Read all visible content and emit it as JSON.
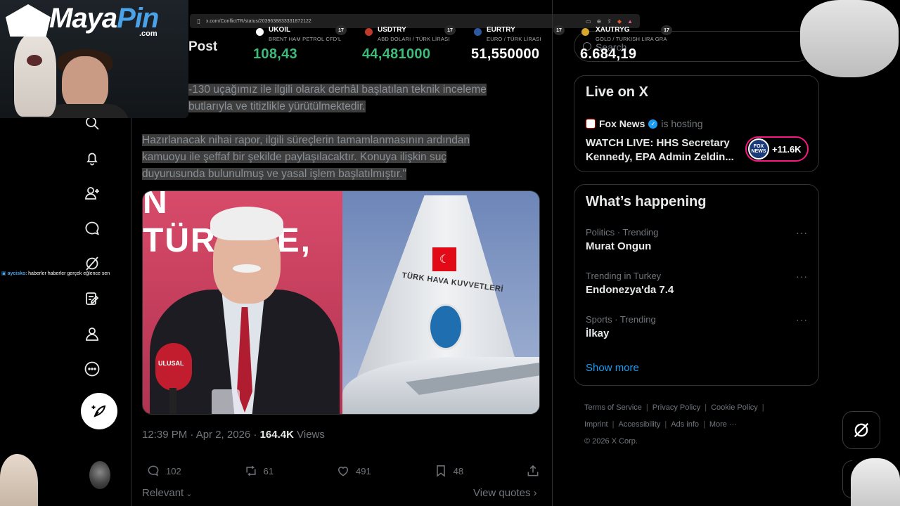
{
  "browser": {
    "url": "x.com/ConflictTR/status/2039638833331872122"
  },
  "ticker": [
    {
      "symbol": "UKOIL",
      "desc": "BRENT HAM PETROL CFD'L",
      "value": "108,43",
      "value_color": "#3dbb7a",
      "dot_color": "#ffffff",
      "tv": "17"
    },
    {
      "symbol": "USDTRY",
      "desc": "ABD DOLARI / TÜRK LİRASI",
      "value": "44,481000",
      "value_color": "#3dbb7a",
      "dot_color": "#c0392b",
      "tv": "17"
    },
    {
      "symbol": "EURTRY",
      "desc": "EURO / TÜRK LİRASI",
      "value": "51,550000",
      "value_color": "#ffffff",
      "dot_color": "#2c5aa0",
      "tv": "17"
    },
    {
      "symbol": "XAUTRYG",
      "desc": "GOLD / TURKISH LIRA GRA",
      "value": "6.684,19",
      "value_color": "#ffffff",
      "dot_color": "#d4a82b",
      "tv": "17"
    }
  ],
  "search": {
    "placeholder": "Search"
  },
  "post": {
    "header": "Post",
    "paragraph1_line1": "-130 uçağımız ile ilgili olarak derhâl başlatılan teknik inceleme",
    "paragraph1_line2": "butlarıyla ve titizlikle yürütülmektedir.",
    "paragraph2_line1": "Hazırlanacak nihai rapor, ilgili süreçlerin tamamlanmasının ardından",
    "paragraph2_line2": "kamuoyu ile şeffaf bir şekilde paylaşılacaktır. Konuya ilişkin suç",
    "paragraph2_line3": "duyurusunda bulunulmuş ve yasal işlem başlatılmıştır.\"",
    "image_banner_text": "N TÜRKİYE,",
    "mic_label": "ULUSAL",
    "plane_text": "TÜRK HAVA KUVVETLERİ",
    "time": "12:39 PM · Apr 2, 2026 · ",
    "views_count": "164.4K",
    "views_label": "Views",
    "replies": "102",
    "reposts": "61",
    "likes": "491",
    "bookmarks": "48",
    "relevant": "Relevant",
    "view_quotes": "View quotes"
  },
  "live": {
    "title": "Live on X",
    "host_name": "Fox News",
    "host_suffix": "is hosting",
    "stream_title": "WATCH LIVE: HHS Secretary Kennedy, EPA Admin Zeldin...",
    "listener_count": "+11.6K",
    "badge_text": "FOX NEWS"
  },
  "happening": {
    "title": "What’s happening",
    "trends": [
      {
        "meta": "Politics · Trending",
        "topic": "Murat Ongun"
      },
      {
        "meta": "Trending in Turkey",
        "topic": "Endonezya'da 7.4"
      },
      {
        "meta": "Sports · Trending",
        "topic": "İlkay"
      }
    ],
    "show_more": "Show more",
    "more_glyph": "···"
  },
  "footer": {
    "links": [
      "Terms of Service",
      "Privacy Policy",
      "Cookie Policy",
      "Imprint",
      "Accessibility",
      "Ads info",
      "More ···"
    ],
    "copyright": "© 2026 X Corp."
  },
  "overlay": {
    "logo_main": "Maya",
    "logo_pin": "Pin",
    "logo_com": ".com",
    "chat_user": "aycisko",
    "chat_msg": ": haberler haberler gerçek eğlence sen"
  },
  "icons": [
    "search-icon",
    "bell-icon",
    "follow-icon",
    "chat-icon",
    "grok-icon",
    "note-icon",
    "profile-icon",
    "more-icon",
    "compose-icon",
    "reply-icon",
    "repost-icon",
    "like-icon",
    "bookmark-icon",
    "share-icon"
  ]
}
